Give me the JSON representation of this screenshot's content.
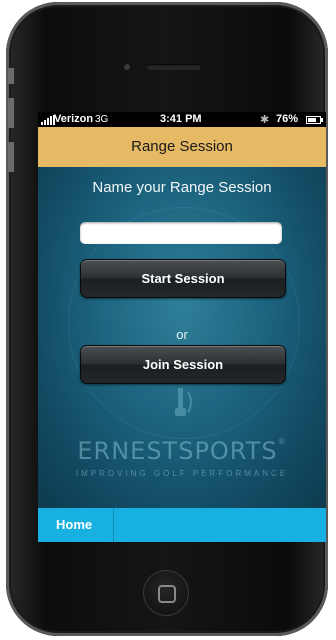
{
  "status_bar": {
    "carrier": "Verizon",
    "network": "3G",
    "time": "3:41 PM",
    "battery_percent": "76%",
    "battery_level": 0.76,
    "bluetooth_icon": "bluetooth-icon"
  },
  "nav_bar": {
    "title": "Range Session"
  },
  "main": {
    "prompt": "Name your Range Session",
    "name_input": {
      "value": "",
      "placeholder": ""
    },
    "start_button_label": "Start Session",
    "or_label": "or",
    "join_button_label": "Join Session"
  },
  "branding": {
    "logo_text": "ERNESTSPORTS",
    "registered_mark": "®",
    "tagline": "IMPROVING GOLF PERFORMANCE"
  },
  "tab_bar": {
    "home_label": "Home"
  },
  "colors": {
    "nav_bar": "#e6b965",
    "tab_bar": "#17b0e0",
    "background": "#1d6580"
  }
}
